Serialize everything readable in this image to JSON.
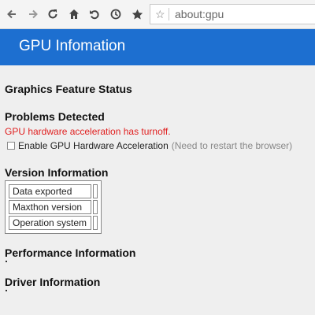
{
  "toolbar": {
    "icons": [
      "back-icon",
      "forward-icon",
      "reload-icon",
      "home-icon",
      "undo-icon",
      "history-icon",
      "favorite-icon"
    ],
    "address": {
      "icon": "star-outline-icon",
      "url": "about:gpu"
    }
  },
  "header": {
    "title": "GPU Infomation",
    "background": "#1d6fd0"
  },
  "sections": {
    "graphics_feature_status": "Graphics Feature Status",
    "problems_detected": "Problems Detected",
    "version_information": "Version Information",
    "performance_information": "Performance Information",
    "driver_information": "Driver Information"
  },
  "problems": {
    "message": "GPU hardware acceleration has turnoff.",
    "checkbox_label": "Enable GPU Hardware Acceleration",
    "checkbox_note": "(Need to restart the browser)",
    "checkbox_checked": false,
    "error_color": "#e02020"
  },
  "version_table": {
    "rows": [
      {
        "key": "Data exported",
        "value": ""
      },
      {
        "key": "Maxthon version",
        "value": ""
      },
      {
        "key": "Operation system",
        "value": ""
      }
    ]
  }
}
